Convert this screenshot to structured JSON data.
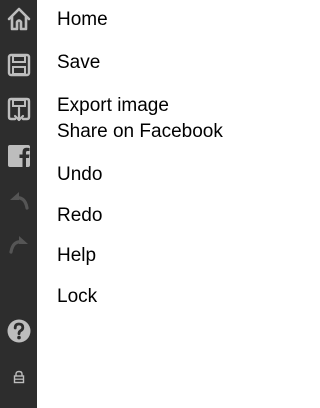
{
  "toolbar": {
    "items": [
      {
        "name": "home",
        "label": "Home",
        "icon": "home-icon",
        "enabled": true
      },
      {
        "name": "save",
        "label": "Save",
        "icon": "floppy-disk-icon",
        "enabled": true
      },
      {
        "name": "export",
        "label": "Export image",
        "icon": "floppy-export-icon",
        "enabled": true
      },
      {
        "name": "share-facebook",
        "label": "Share on Facebook",
        "icon": "facebook-icon",
        "enabled": true
      },
      {
        "name": "undo",
        "label": "Undo",
        "icon": "undo-arrow-icon",
        "enabled": false
      },
      {
        "name": "redo",
        "label": "Redo",
        "icon": "redo-arrow-icon",
        "enabled": false
      },
      {
        "name": "help",
        "label": "Help",
        "icon": "question-mark-icon",
        "enabled": true
      },
      {
        "name": "lock",
        "label": "Lock",
        "icon": "lock-icon",
        "enabled": true
      }
    ]
  },
  "colors": {
    "toolbar_bg": "#2d2d2d",
    "icon_enabled": "#bdbdbd",
    "icon_disabled": "#555555",
    "label_text": "#000000"
  }
}
